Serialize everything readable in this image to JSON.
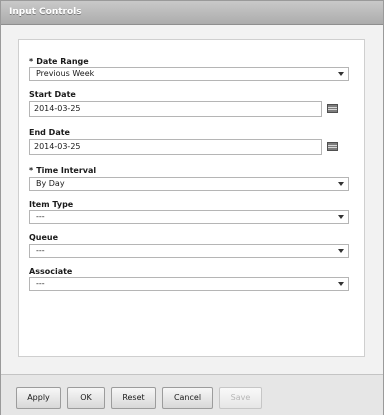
{
  "dialog": {
    "title": "Input Controls"
  },
  "controls": {
    "date_range": {
      "required_mark": "*",
      "label": "Date Range",
      "value": "Previous Week"
    },
    "start_date": {
      "label": "Start Date",
      "value": "2014-03-25",
      "icon": "calendar-icon"
    },
    "end_date": {
      "label": "End Date",
      "value": "2014-03-25",
      "icon": "calendar-icon"
    },
    "time_interval": {
      "required_mark": "*",
      "label": "Time Interval",
      "value": "By Day"
    },
    "item_type": {
      "label": "Item Type",
      "value": "---"
    },
    "queue": {
      "label": "Queue",
      "value": "---"
    },
    "associate": {
      "label": "Associate",
      "value": "---"
    }
  },
  "footer": {
    "apply_label": "Apply",
    "ok_label": "OK",
    "reset_label": "Reset",
    "cancel_label": "Cancel",
    "save_label": "Save",
    "save_enabled": false
  }
}
